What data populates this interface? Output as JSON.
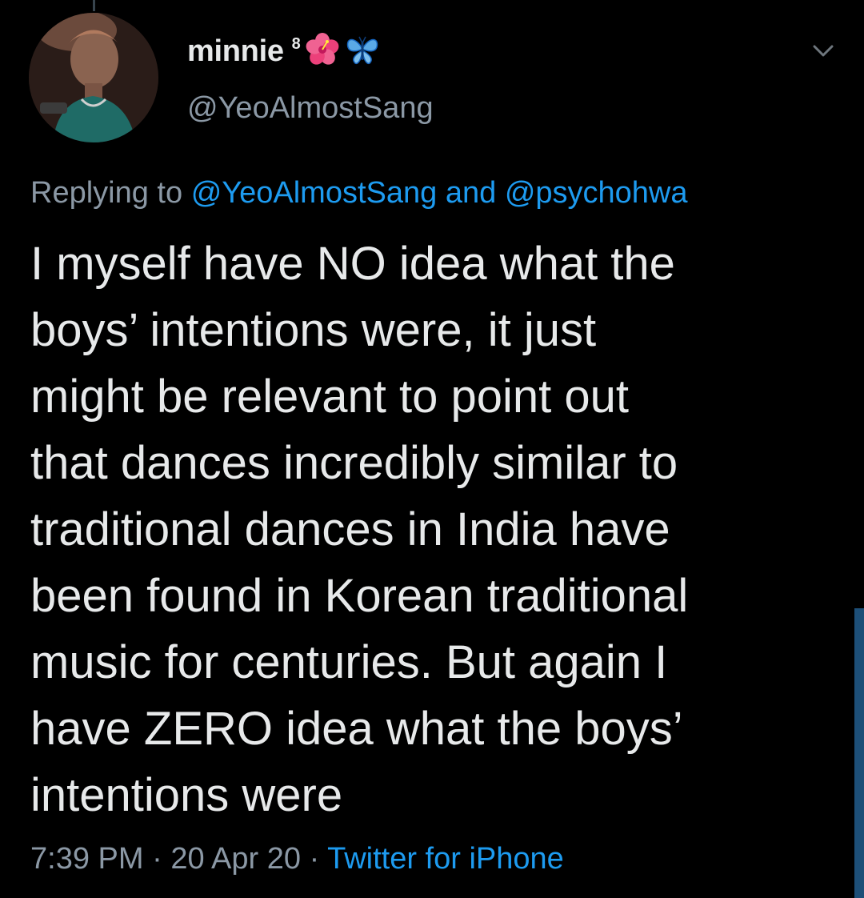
{
  "author": {
    "display_name": "minnie",
    "superscript": "8",
    "name_emojis": [
      "hibiscus-icon",
      "butterfly-icon"
    ],
    "handle": "@YeoAlmostSang"
  },
  "reply": {
    "prefix": "Replying to",
    "mention_1": "@YeoAlmostSang",
    "conjunction": "and",
    "mention_2": "@psychohwa"
  },
  "tweet": {
    "lines": [
      "I myself have NO idea what the",
      "boys’ intentions were, it just",
      "might be relevant to point out",
      "that dances incredibly similar to",
      "traditional dances in India have",
      "been found in Korean traditional",
      "music for centuries. But again I",
      "have ZERO idea what the boys’",
      "intentions were"
    ]
  },
  "meta": {
    "time": "7:39 PM",
    "separator": "·",
    "date": "20 Apr 20",
    "source": "Twitter for iPhone"
  },
  "colors": {
    "background": "#000000",
    "text": "#e7e9ea",
    "secondary": "#8b98a5",
    "link": "#1d9bf0"
  }
}
